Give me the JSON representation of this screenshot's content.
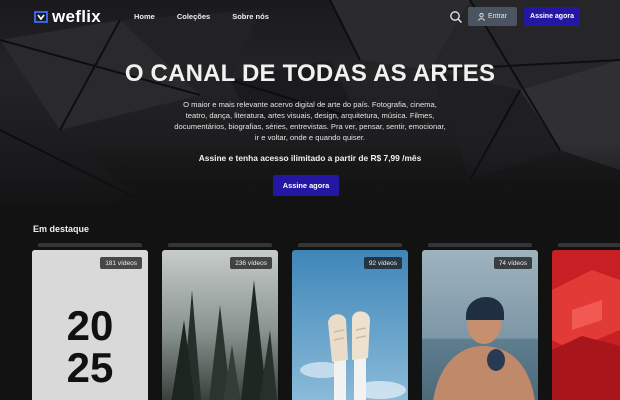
{
  "brand": {
    "name": "weflix"
  },
  "nav": {
    "items": [
      "Home",
      "Coleções",
      "Sobre nós"
    ],
    "enter_label": "Entrar",
    "subscribe_label": "Assine agora"
  },
  "hero": {
    "title": "O CANAL DE TODAS AS ARTES",
    "description": "O maior e mais relevante acervo digital de arte do país. Fotografia, cinema, teatro, dança, literatura, artes visuais, design, arquitetura, música. Filmes, documentários, biografias, séries, entrevistas. Pra ver, pensar, sentir, emocionar, ir e voltar, onde e quando quiser.",
    "offer": "Assine e tenha acesso ilimitado a partir de R$ 7,99 /mês",
    "cta_label": "Assine agora"
  },
  "featured": {
    "title": "Em destaque",
    "cards": [
      {
        "badge": "181 vídeos",
        "art_text_line1": "20",
        "art_text_line2": "25"
      },
      {
        "badge": "236 vídeos"
      },
      {
        "badge": "92 vídeos"
      },
      {
        "badge": "74 vídeos"
      },
      {
        "badge": ""
      }
    ]
  },
  "colors": {
    "accent": "#2417a3",
    "enter_button": "#4b5561",
    "background": "#121213"
  }
}
